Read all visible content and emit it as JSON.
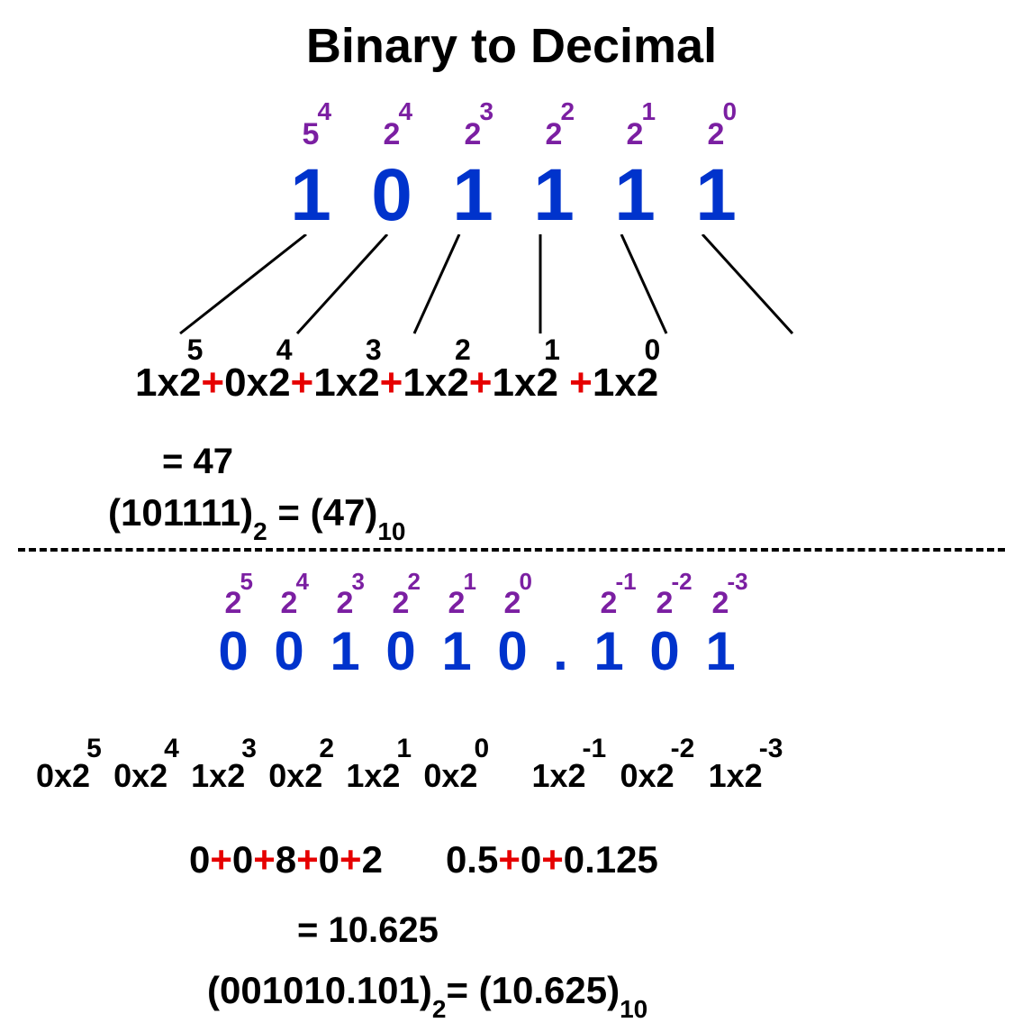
{
  "title": "Binary to Decimal",
  "ex1": {
    "powers": [
      {
        "base": "5",
        "exp": "4"
      },
      {
        "base": "2",
        "exp": "4"
      },
      {
        "base": "2",
        "exp": "3"
      },
      {
        "base": "2",
        "exp": "2"
      },
      {
        "base": "2",
        "exp": "1"
      },
      {
        "base": "2",
        "exp": "0"
      }
    ],
    "digits": [
      "1",
      "0",
      "1",
      "1",
      "1",
      "1"
    ],
    "terms": [
      {
        "t": "1x2",
        "e": "5"
      },
      {
        "t": "0x2",
        "e": "4"
      },
      {
        "t": "1x2",
        "e": "3"
      },
      {
        "t": "1x2",
        "e": "2"
      },
      {
        "t": "1x2",
        "e": "1"
      },
      {
        "t": "1x2",
        "e": "0"
      }
    ],
    "result": "= 47",
    "conc_a": "(101111)",
    "conc_asub": "2",
    "conc_eq": " = ",
    "conc_b": "(47)",
    "conc_bsub": "10"
  },
  "ex2": {
    "powers": [
      {
        "base": "2",
        "exp": "5"
      },
      {
        "base": "2",
        "exp": "4"
      },
      {
        "base": "2",
        "exp": "3"
      },
      {
        "base": "2",
        "exp": "2"
      },
      {
        "base": "2",
        "exp": "1"
      },
      {
        "base": "2",
        "exp": "0"
      },
      {
        "base": "2",
        "exp": "-1"
      },
      {
        "base": "2",
        "exp": "-2"
      },
      {
        "base": "2",
        "exp": "-3"
      }
    ],
    "digits": [
      "0",
      "0",
      "1",
      "0",
      "1",
      "0",
      ".",
      "1",
      "0",
      "1"
    ],
    "terms": [
      {
        "t": "0x2",
        "e": "5"
      },
      {
        "t": "0x2",
        "e": "4"
      },
      {
        "t": "1x2",
        "e": "3"
      },
      {
        "t": "0x2",
        "e": "2"
      },
      {
        "t": "1x2",
        "e": "1"
      },
      {
        "t": "0x2",
        "e": "0"
      },
      {
        "t": "1x2",
        "e": "-1"
      },
      {
        "t": "0x2",
        "e": "-2"
      },
      {
        "t": "1x2",
        "e": "-3"
      }
    ],
    "sumsL": [
      "0",
      "0",
      "8",
      "0",
      "2"
    ],
    "sumsR": [
      "0.5",
      "0",
      "0.125"
    ],
    "result": "= 10.625",
    "conc_a": "(001010.101)",
    "conc_asub": "2",
    "conc_eq": "= ",
    "conc_b": "(10.625)",
    "conc_bsub": "10"
  }
}
